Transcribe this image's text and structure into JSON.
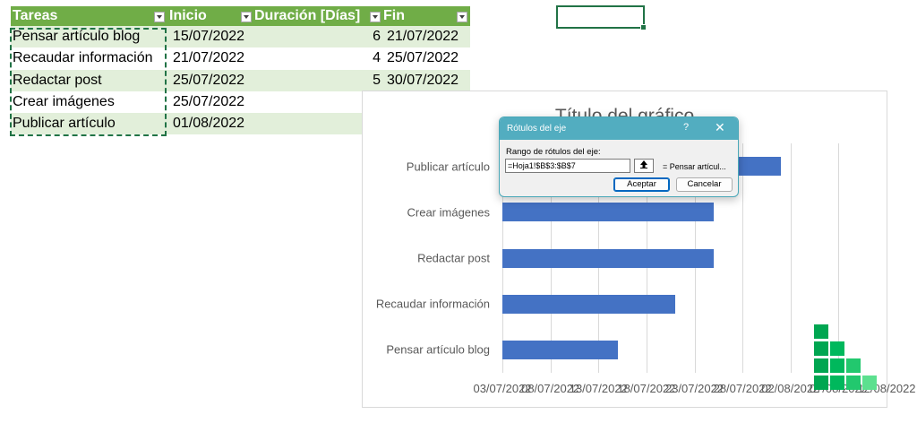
{
  "table": {
    "headers": [
      "Tareas",
      "Inicio",
      "Duración [Días]",
      "Fin"
    ],
    "rows": [
      {
        "task": "Pensar artículo blog",
        "start": "15/07/2022",
        "duration": "6",
        "end": "21/07/2022"
      },
      {
        "task": "Recaudar información",
        "start": "21/07/2022",
        "duration": "4",
        "end": "25/07/2022"
      },
      {
        "task": "Redactar post",
        "start": "25/07/2022",
        "duration": "5",
        "end": "30/07/2022"
      },
      {
        "task": "Crear imágenes",
        "start": "25/07/2022",
        "duration": "",
        "end": ""
      },
      {
        "task": "Publicar artículo",
        "start": "01/08/2022",
        "duration": "",
        "end": ""
      }
    ]
  },
  "chart": {
    "title": "Título del gráfico",
    "categories": [
      "Publicar artículo",
      "Crear imágenes",
      "Redactar post",
      "Recaudar información",
      "Pensar artículo blog"
    ],
    "x_tick_labels": [
      "03/07/2022",
      "08/07/2022",
      "13/07/2022",
      "18/07/2022",
      "23/07/2022",
      "28/07/2022",
      "02/08/2022",
      "07/08/2022",
      "12/08/2022"
    ]
  },
  "chart_data": {
    "type": "bar",
    "orientation": "horizontal",
    "title": "Título del gráfico",
    "categories": [
      "Pensar artículo blog",
      "Recaudar información",
      "Redactar post",
      "Crear imágenes",
      "Publicar artículo"
    ],
    "values": [
      "2022-07-15",
      "2022-07-21",
      "2022-07-25",
      "2022-07-25",
      "2022-08-01"
    ],
    "x_ticks": [
      "03/07/2022",
      "08/07/2022",
      "13/07/2022",
      "18/07/2022",
      "23/07/2022",
      "28/07/2022",
      "02/08/2022",
      "07/08/2022",
      "12/08/2022"
    ],
    "grid": true,
    "legend": "none"
  },
  "dialog": {
    "title": "Rótulos del eje",
    "help": "?",
    "close": "✕",
    "range_label": "Rango de rótulos del eje:",
    "range_value": "=Hoja1!$B$3:$B$7",
    "preview": "= Pensar artícul...",
    "ok_label": "Aceptar",
    "cancel_label": "Cancelar"
  },
  "colors": {
    "header_green": "#70ad47",
    "band_green": "#e2efda",
    "bar_blue": "#4472c4",
    "dialog_accent": "#52adc0"
  }
}
